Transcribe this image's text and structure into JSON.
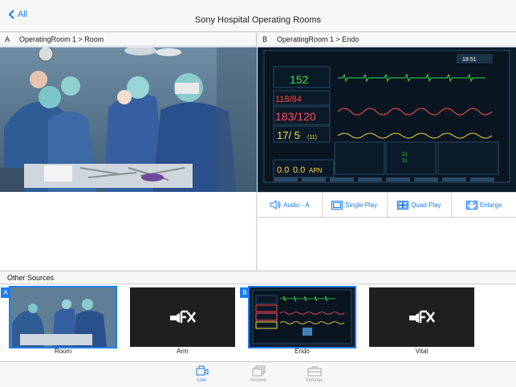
{
  "nav": {
    "back_label": "All",
    "title": "Sony Hospital Operating Rooms"
  },
  "panels": [
    {
      "slot": "A",
      "path": "OperatingRoom 1 > Room"
    },
    {
      "slot": "B",
      "path": "OperatingRoom 1 > Endo"
    }
  ],
  "monitor": {
    "clock": "18:51",
    "hr": "152",
    "nibp": "118/84",
    "abp": "183/120",
    "pap": "17/ 5",
    "pap_mean": "(11)",
    "temp_a": "0.0",
    "temp_b": "0.0",
    "mode": "APN",
    "spo2_a": "21",
    "spo2_b": "21"
  },
  "controls": [
    {
      "label": "Audio - A",
      "icon": "speaker-icon"
    },
    {
      "label": "Single Play",
      "icon": "single-screen-icon"
    },
    {
      "label": "Quad Play",
      "icon": "quad-screen-icon"
    },
    {
      "label": "Enlarge",
      "icon": "enlarge-icon"
    }
  ],
  "other_sources": {
    "title": "Other Sources",
    "items": [
      {
        "label": "Room",
        "badge": "A"
      },
      {
        "label": "Arm",
        "badge": ""
      },
      {
        "label": "Endo",
        "badge": "B"
      },
      {
        "label": "Vital",
        "badge": ""
      }
    ]
  },
  "tabs": [
    {
      "label": "Live",
      "icon": "live-camera-icon"
    },
    {
      "label": "Archive",
      "icon": "archive-icon"
    },
    {
      "label": "Settings",
      "icon": "settings-toolbox-icon"
    }
  ],
  "colors": {
    "accent": "#1a7cf2"
  }
}
